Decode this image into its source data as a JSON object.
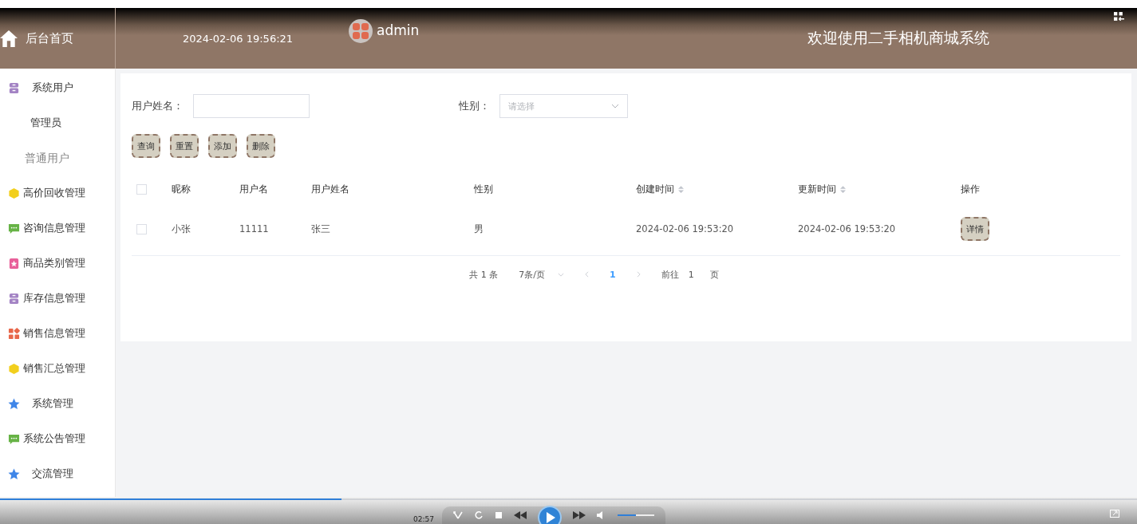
{
  "header": {
    "home_label": "后台首页",
    "datetime": "2024-02-06 19:56:21",
    "user": "admin",
    "title": "欢迎使用二手相机商城系统"
  },
  "sidebar": {
    "items": [
      {
        "label": "系统用户",
        "kind": "archive",
        "color": "#a383c4",
        "submenu": true,
        "children": [
          {
            "label": "管理员",
            "selected": false
          },
          {
            "label": "普通用户",
            "selected": true
          }
        ]
      },
      {
        "label": "高价回收管理",
        "kind": "cube",
        "color": "#f2cf1d",
        "submenu": false
      },
      {
        "label": "咨询信息管理",
        "kind": "chat",
        "color": "#67b346",
        "submenu": false
      },
      {
        "label": "商品类别管理",
        "kind": "tag",
        "color": "#e8609a",
        "submenu": false
      },
      {
        "label": "库存信息管理",
        "kind": "archive",
        "color": "#a383c4",
        "submenu": false
      },
      {
        "label": "销售信息管理",
        "kind": "grid",
        "color": "#e8674a",
        "submenu": false
      },
      {
        "label": "销售汇总管理",
        "kind": "cube",
        "color": "#f2cf1d",
        "submenu": false
      },
      {
        "label": "系统管理",
        "kind": "star",
        "color": "#3f86e8",
        "submenu": true
      },
      {
        "label": "系统公告管理",
        "kind": "chat",
        "color": "#67b346",
        "submenu": false
      },
      {
        "label": "交流管理",
        "kind": "star",
        "color": "#3f86e8",
        "submenu": true
      }
    ]
  },
  "filters": [
    {
      "label": "用户姓名：",
      "kind": "text"
    },
    {
      "label": "性别：",
      "kind": "select",
      "placeholder": "请选择"
    }
  ],
  "buttons": [
    "查询",
    "重置",
    "添加",
    "删除"
  ],
  "table": {
    "all_checked": false,
    "columns": [
      {
        "label": "昵称",
        "sortable": false
      },
      {
        "label": "用户名",
        "sortable": false
      },
      {
        "label": "用户姓名",
        "sortable": false
      },
      {
        "label": "性别",
        "sortable": false
      },
      {
        "label": "创建时间",
        "sortable": true
      },
      {
        "label": "更新时间",
        "sortable": true
      },
      {
        "label": "操作",
        "sortable": false
      }
    ],
    "rows": [
      {
        "checked": false,
        "cells": [
          "小张",
          "11111",
          "张三",
          "男",
          "2024-02-06 19:53:20",
          "2024-02-06 19:53:20"
        ],
        "action": "详情"
      }
    ]
  },
  "pagination": {
    "total": "共 1 条",
    "page_size": "7条/页",
    "current": "1",
    "goto_label": "前往",
    "goto_value": "1",
    "page_suffix": "页"
  },
  "player": {
    "time": "02:57",
    "progress": {
      "level": 0.3
    },
    "volume": {
      "level": 0.5
    }
  }
}
